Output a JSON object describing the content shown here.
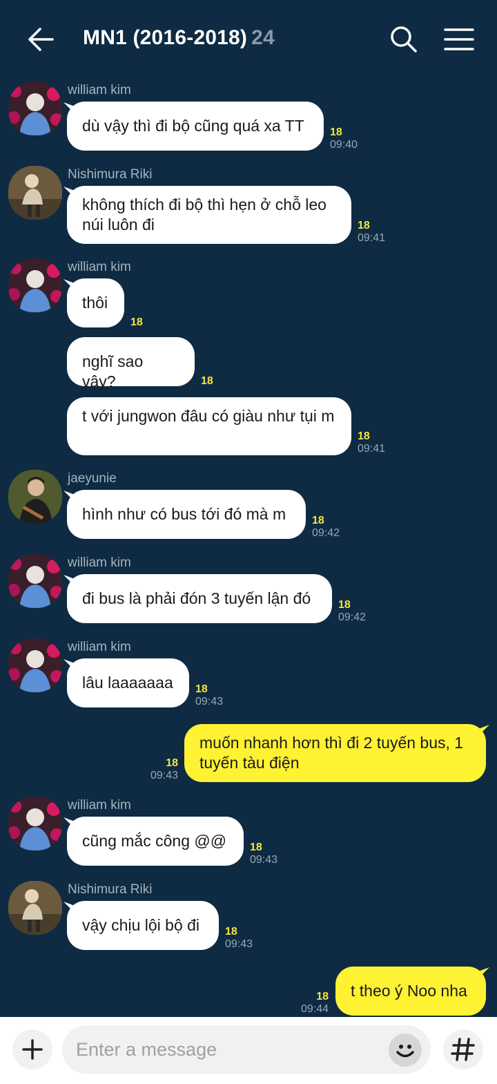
{
  "header": {
    "title": "MN1 (2016-2018)",
    "member_count": "24"
  },
  "messages": [
    {
      "sender": "william kim",
      "text": "dù vậy thì đi bộ cũng quá xa TT",
      "unread": "18",
      "time": "09:40"
    },
    {
      "sender": "Nishimura Riki",
      "text": "không thích đi bộ thì hẹn ở chỗ leo núi luôn đi",
      "unread": "18",
      "time": "09:41"
    },
    {
      "sender": "william kim",
      "text": "thôi",
      "unread": "18",
      "time": ""
    },
    {
      "sender": "",
      "text": "nghĩ sao vậy?",
      "unread": "18",
      "time": ""
    },
    {
      "sender": "",
      "text": "t với jungwon đâu có giàu như tụi m",
      "unread": "18",
      "time": "09:41"
    },
    {
      "sender": "jaeyunie",
      "text": "hình như có bus tới đó mà m",
      "unread": "18",
      "time": "09:42"
    },
    {
      "sender": "william kim",
      "text": "đi bus là phải đón 3 tuyến lận đó",
      "unread": "18",
      "time": "09:42"
    },
    {
      "sender": "william kim",
      "text": "lâu laaaaaaa",
      "unread": "18",
      "time": "09:43"
    },
    {
      "sender": "me",
      "text": "muốn nhanh hơn thì đi 2 tuyến bus, 1 tuyến tàu điện",
      "unread": "18",
      "time": "09:43"
    },
    {
      "sender": "william kim",
      "text": "cũng mắc công @@",
      "unread": "18",
      "time": "09:43"
    },
    {
      "sender": "Nishimura Riki",
      "text": "vậy chịu lội bộ đi",
      "unread": "18",
      "time": "09:43"
    },
    {
      "sender": "me",
      "text": "t theo ý Noo nha",
      "unread": "18",
      "time": "09:44"
    }
  ],
  "composer": {
    "placeholder": "Enter a message"
  },
  "colors": {
    "background": "#0e2b43",
    "my_bubble": "#fff233",
    "other_bubble": "#ffffff",
    "unread": "#f5e63a"
  },
  "icons": [
    "back-arrow-icon",
    "search-icon",
    "menu-icon",
    "plus-icon",
    "emoji-icon",
    "hashtag-icon"
  ]
}
